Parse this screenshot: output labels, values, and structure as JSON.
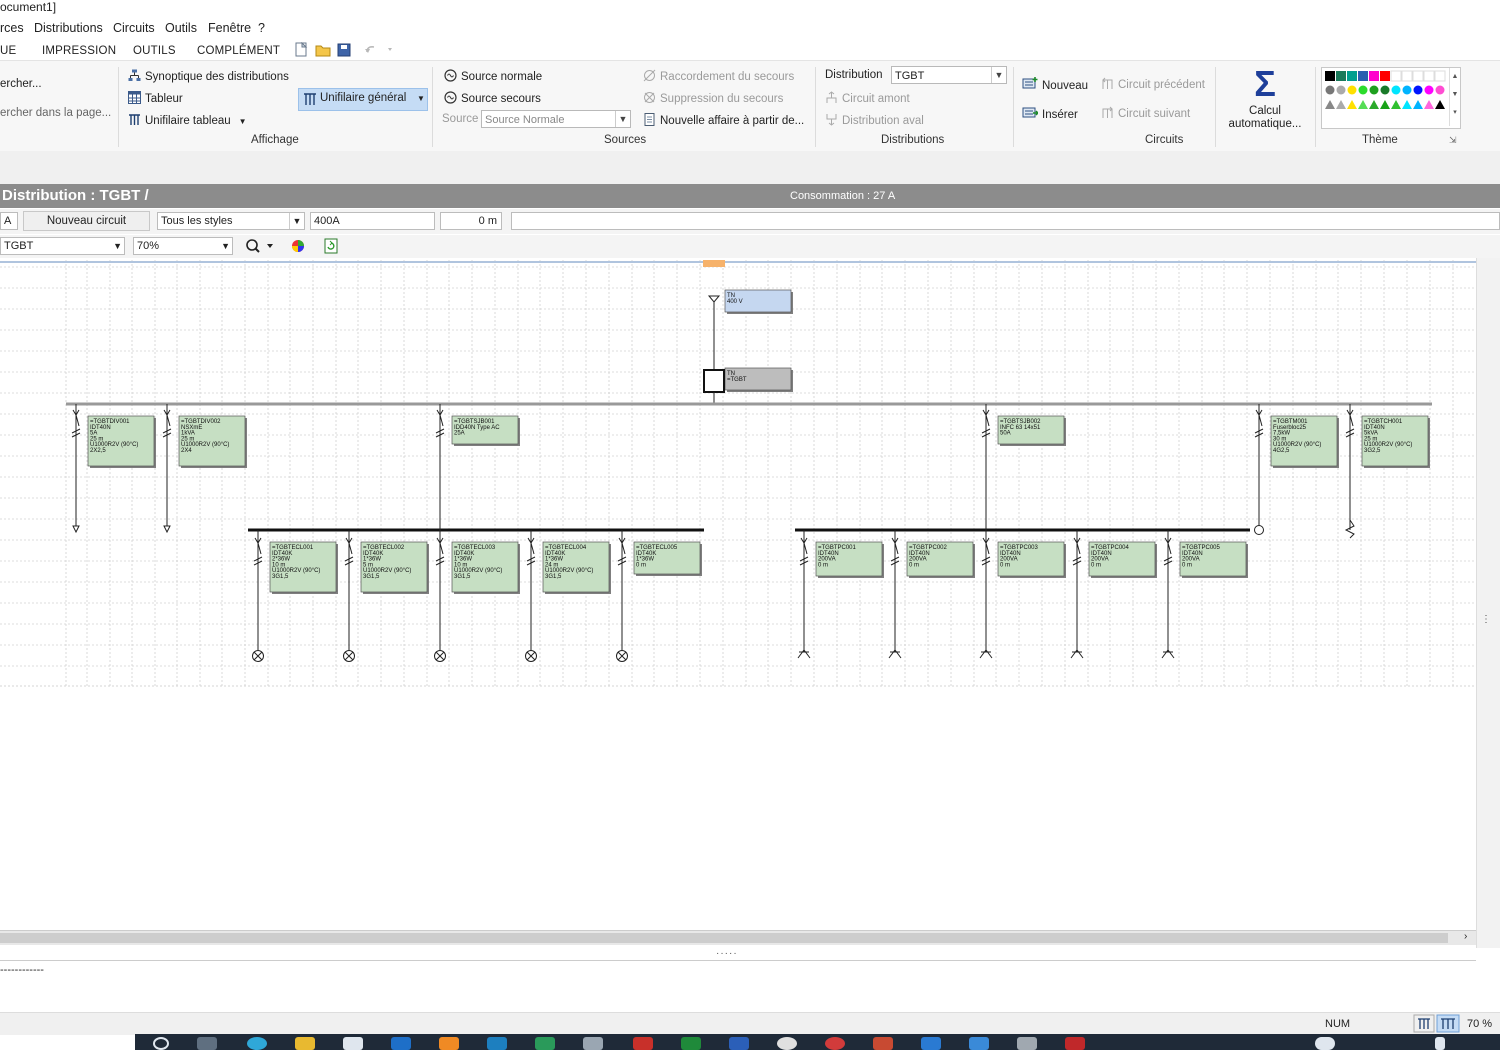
{
  "window": {
    "title": "ocument1]"
  },
  "menu": [
    "rces",
    "Distributions",
    "Circuits",
    "Outils",
    "Fenêtre",
    "?"
  ],
  "tabs": [
    "UE",
    "IMPRESSION",
    "OUTILS",
    "COMPLÉMENT"
  ],
  "ribbon": {
    "search": {
      "label": "ercher...",
      "page_label": "ercher dans la page..."
    },
    "affichage": {
      "label": "Affichage",
      "synoptique": "Synoptique des distributions",
      "tableur": "Tableur",
      "unifilaire_tableau": "Unifilaire tableau",
      "unifilaire_general": "Unifilaire général"
    },
    "sources": {
      "label": "Sources",
      "normale": "Source normale",
      "secours": "Source secours",
      "source_label": "Source",
      "source_value": "Source Normale",
      "raccordement": "Raccordement du secours",
      "suppression": "Suppression du secours",
      "nouvelle_affaire": "Nouvelle affaire à partir de..."
    },
    "distributions": {
      "label": "Distributions",
      "distribution_label": "Distribution",
      "distribution_value": "TGBT",
      "amont": "Circuit amont",
      "aval": "Distribution aval"
    },
    "circuits": {
      "label": "Circuits",
      "nouveau": "Nouveau",
      "inserer": "Insérer",
      "precedent": "Circuit précédent",
      "suivant": "Circuit suivant",
      "calcul_line1": "Calcul",
      "calcul_line2": "automatique..."
    },
    "theme": {
      "label": "Thème"
    }
  },
  "distribution": {
    "title": "Distribution : TGBT /",
    "consommation": "Consommation : 27 A"
  },
  "toolbar1": {
    "left": "A",
    "nouveau_circuit": "Nouveau circuit",
    "styles": "Tous les styles",
    "current": "400A",
    "length": "0 m"
  },
  "toolbar2": {
    "dist": "TGBT",
    "zoom": "70%"
  },
  "diagram": {
    "source": {
      "l1": "TN",
      "l2": "400 V"
    },
    "tgbt": {
      "l1": "TN",
      "l2": "=TGBT"
    },
    "boxes": [
      {
        "id": "TGBTDIV001",
        "lines": [
          "=TGBTDIV001",
          "IDT40N",
          "5A",
          "25 m",
          "U1000R2V (90°C)",
          "2X2,5"
        ]
      },
      {
        "id": "TGBTDIV002",
        "lines": [
          "=TGBTDIV002",
          "NSXmE",
          "1kVA",
          "25 m",
          "U1000R2V (90°C)",
          "2X4"
        ]
      },
      {
        "id": "TGBTSJB001",
        "lines": [
          "=TGBTSJB001",
          "IDD40N Type AC",
          "25A"
        ]
      },
      {
        "id": "TGBTSJB002",
        "lines": [
          "=TGBTSJB002",
          "INFC 63 14x51",
          "50A"
        ]
      },
      {
        "id": "TGBTM001",
        "lines": [
          "=TGBTM001",
          "Fuserbloc25",
          "7,5kW",
          "30 m",
          "U1000R2V (90°C)",
          "4G2,5"
        ]
      },
      {
        "id": "TGBTCH001",
        "lines": [
          "=TGBTCH001",
          "IDT40N",
          "5kVA",
          "25 m",
          "U1000R2V (90°C)",
          "3G2,5"
        ]
      },
      {
        "id": "TGBTECL001",
        "lines": [
          "=TGBTECL001",
          "IDT40K",
          "2*36W",
          "10 m",
          "U1000R2V (90°C)",
          "3G1,5"
        ]
      },
      {
        "id": "TGBTECL002",
        "lines": [
          "=TGBTECL002",
          "IDT40K",
          "1*36W",
          "5 m",
          "U1000R2V (90°C)",
          "3G1,5"
        ]
      },
      {
        "id": "TGBTECL003",
        "lines": [
          "=TGBTECL003",
          "IDT40K",
          "1*36W",
          "10 m",
          "U1000R2V (90°C)",
          "3G1,5"
        ]
      },
      {
        "id": "TGBTECL004",
        "lines": [
          "=TGBTECL004",
          "IDT40K",
          "1*36W",
          "24 m",
          "U1000R2V (90°C)",
          "3G1,5"
        ]
      },
      {
        "id": "TGBTECL005",
        "lines": [
          "=TGBTECL005",
          "IDT40K",
          "1*36W",
          "0 m"
        ]
      },
      {
        "id": "TGBTPC001",
        "lines": [
          "=TGBTPC001",
          "IDT40N",
          "200VA",
          "0 m"
        ]
      },
      {
        "id": "TGBTPC002",
        "lines": [
          "=TGBTPC002",
          "IDT40N",
          "200VA",
          "0 m"
        ]
      },
      {
        "id": "TGBTPC003",
        "lines": [
          "=TGBTPC003",
          "IDT40N",
          "200VA",
          "0 m"
        ]
      },
      {
        "id": "TGBTPC004",
        "lines": [
          "=TGBTPC004",
          "IDT40N",
          "200VA",
          "0 m"
        ]
      },
      {
        "id": "TGBTPC005",
        "lines": [
          "=TGBTPC005",
          "IDT40N",
          "200VA",
          "0 m"
        ]
      }
    ]
  },
  "bottom": {
    "dashes": "------------"
  },
  "status": {
    "num": "NUM",
    "zoom": "70 %"
  },
  "colors": {
    "box_green": "#c6dfc3",
    "box_blue": "#c5d7f0",
    "box_gray": "#bdbdbd",
    "header_gray": "#8c8c8c"
  }
}
